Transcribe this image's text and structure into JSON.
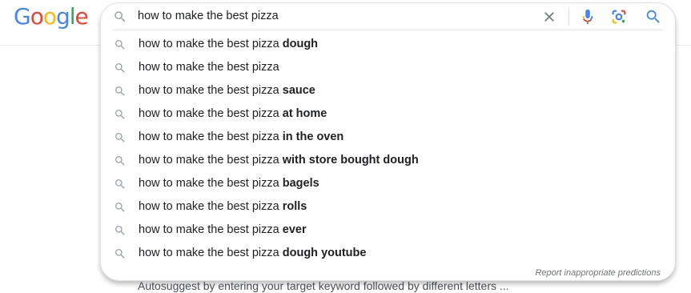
{
  "logo": {
    "text": "Google"
  },
  "search": {
    "value": "how to make the best pizza"
  },
  "suggestions": [
    {
      "base": "how to make the best pizza",
      "bold": "dough"
    },
    {
      "base": "how to make the best pizza",
      "bold": ""
    },
    {
      "base": "how to make the best pizza",
      "bold": "sauce"
    },
    {
      "base": "how to make the best pizza",
      "bold": "at home"
    },
    {
      "base": "how to make the best pizza",
      "bold": "in the oven"
    },
    {
      "base": "how to make the best pizza",
      "bold": "with store bought dough"
    },
    {
      "base": "how to make the best pizza",
      "bold": "bagels"
    },
    {
      "base": "how to make the best pizza",
      "bold": "rolls"
    },
    {
      "base": "how to make the best pizza",
      "bold": "ever"
    },
    {
      "base": "how to make the best pizza",
      "bold": "dough youtube"
    }
  ],
  "report_link": "Report inappropriate predictions",
  "background_text": "Autosuggest by entering your target keyword followed by different letters ...",
  "colors": {
    "blue": "#4285f4",
    "red": "#ea4335",
    "yellow": "#fbbc05",
    "green": "#34a853",
    "icon_gray": "#9aa0a6"
  },
  "icons": {
    "search": "search-icon",
    "clear": "close-icon",
    "voice": "microphone-icon",
    "lens": "lens-camera-icon",
    "submit": "search-submit-icon"
  }
}
